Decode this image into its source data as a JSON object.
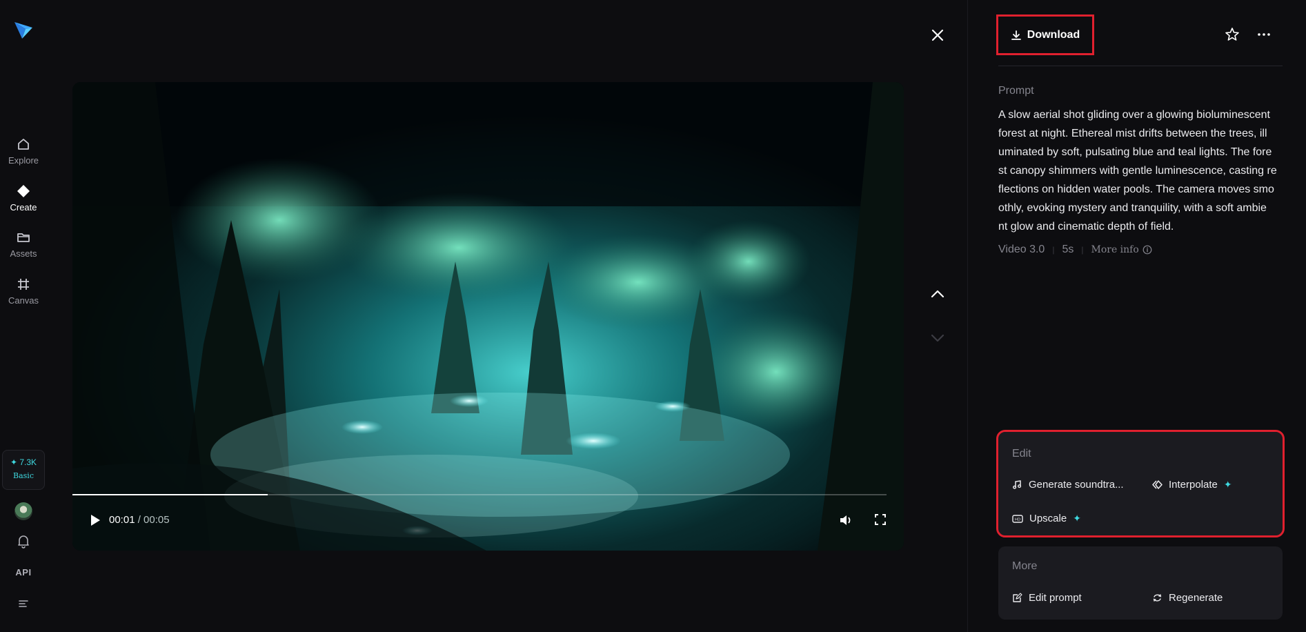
{
  "nav": {
    "items": [
      {
        "label": "Explore",
        "icon": "home-icon"
      },
      {
        "label": "Create",
        "icon": "diamond-icon"
      },
      {
        "label": "Assets",
        "icon": "folder-icon"
      },
      {
        "label": "Canvas",
        "icon": "frame-icon"
      }
    ],
    "credits": {
      "amount": "7.3K",
      "plan": "Basic"
    },
    "api_label": "API"
  },
  "player": {
    "current_time": "00:01",
    "duration": "/ 00:05",
    "progress_fraction": 0.24
  },
  "panel": {
    "download_label": "Download",
    "prompt_label": "Prompt",
    "prompt_lines": [
      "A slow aerial shot gliding over a glowing bioluminescent",
      "forest at night. Ethereal mist drifts between the trees, ill",
      "uminated by soft, pulsating blue and teal lights. The fore",
      "st canopy shimmers with gentle luminescence, casting re",
      "flections on hidden water pools. The camera moves smo",
      "othly, evoking mystery and tranquility, with a soft ambie",
      "nt glow and cinematic depth of field."
    ],
    "meta": {
      "model": "Video 3.0",
      "length": "5s",
      "more_info": "More info"
    },
    "edit": {
      "title": "Edit",
      "generate_soundtrack": "Generate soundtra...",
      "interpolate": "Interpolate",
      "upscale": "Upscale"
    },
    "more": {
      "title": "More",
      "edit_prompt": "Edit prompt",
      "regenerate": "Regenerate"
    }
  },
  "colors": {
    "accent": "#3fd9e0",
    "highlight": "#e0202e",
    "background": "#0d0d10",
    "card": "#1b1b20"
  }
}
